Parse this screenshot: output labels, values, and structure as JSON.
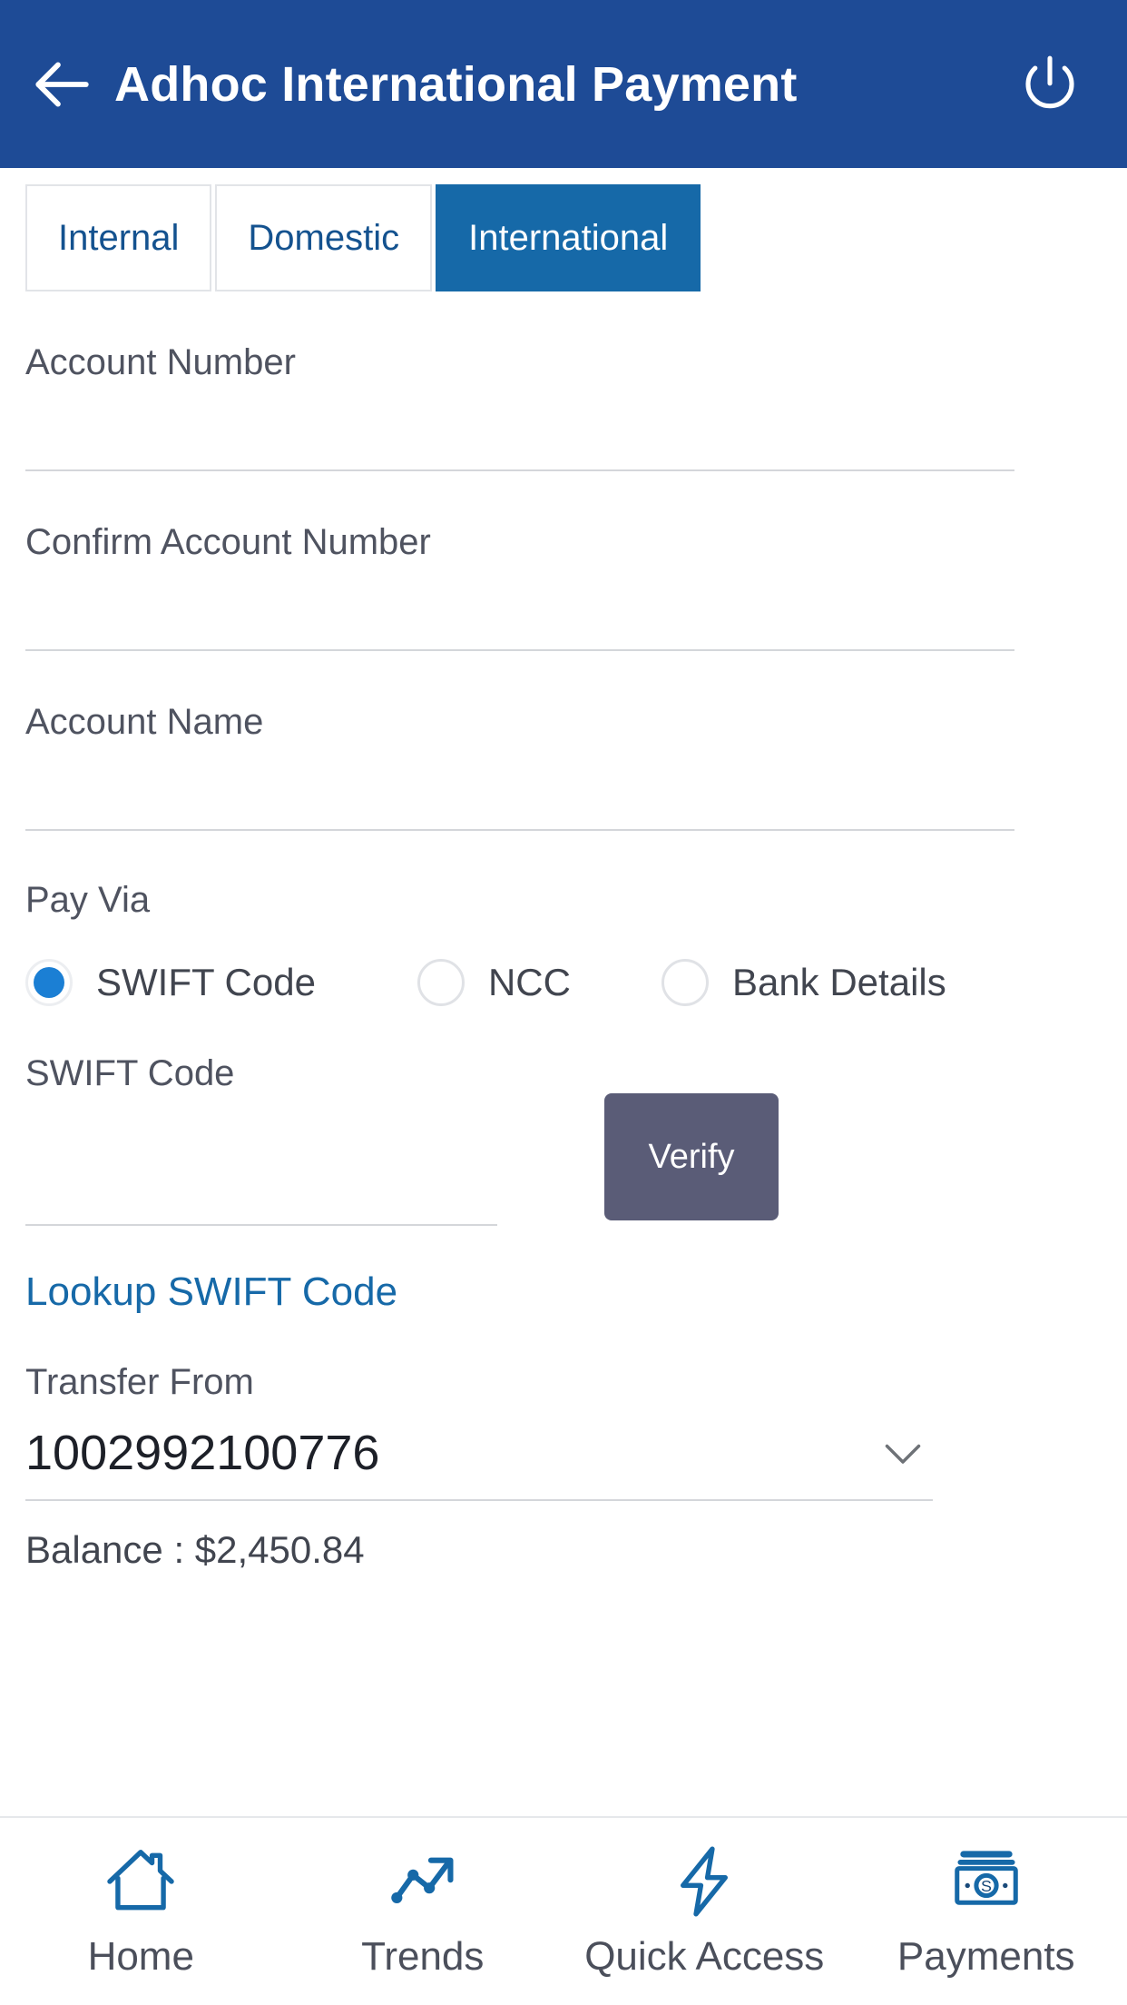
{
  "header": {
    "title": "Adhoc International Payment",
    "back_icon": "back-arrow-icon",
    "power_icon": "power-icon",
    "background_color": "#1e4b96"
  },
  "tabs": {
    "items": [
      {
        "label": "Internal",
        "active": false
      },
      {
        "label": "Domestic",
        "active": false
      },
      {
        "label": "International",
        "active": true
      }
    ],
    "active_color": "#1669a8",
    "inactive_text_color": "#14528f"
  },
  "form": {
    "account_number": {
      "label": "Account Number",
      "value": "",
      "placeholder": ""
    },
    "confirm_account_number": {
      "label": "Confirm Account Number",
      "value": "",
      "placeholder": ""
    },
    "account_name": {
      "label": "Account Name",
      "value": "",
      "placeholder": ""
    },
    "pay_via": {
      "label": "Pay Via",
      "options": [
        {
          "label": "SWIFT Code",
          "selected": true
        },
        {
          "label": "NCC",
          "selected": false
        },
        {
          "label": "Bank Details",
          "selected": false
        }
      ],
      "selected_color": "#1b7fd4"
    },
    "swift_code": {
      "label": "SWIFT Code",
      "value": "",
      "placeholder": "",
      "verify_label": "Verify",
      "verify_color": "#5a5c77"
    },
    "lookup_link": "Lookup SWIFT Code",
    "transfer_from": {
      "label": "Transfer From",
      "value": "1002992100776",
      "chevron_icon": "chevron-down-icon",
      "balance": "Balance : $2,450.84"
    }
  },
  "bottom_nav": {
    "items": [
      {
        "label": "Home",
        "icon": "home-icon"
      },
      {
        "label": "Trends",
        "icon": "trend-line-icon"
      },
      {
        "label": "Quick Access",
        "icon": "lightning-bolt-icon"
      },
      {
        "label": "Payments",
        "icon": "banknote-icon"
      }
    ],
    "icon_color": "#1669a8"
  }
}
